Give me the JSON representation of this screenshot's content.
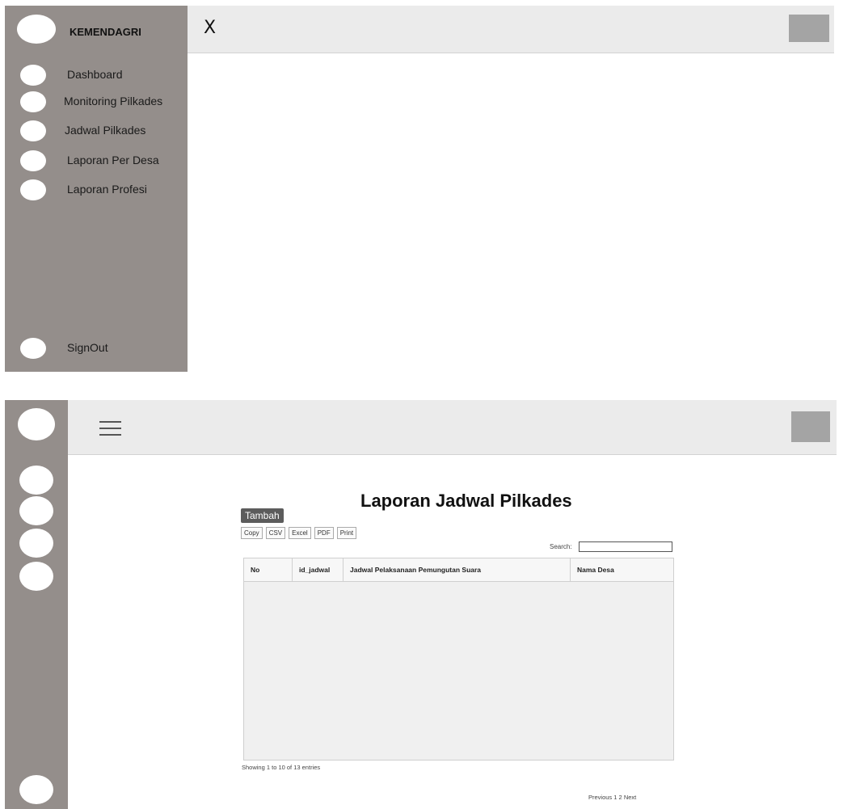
{
  "expanded_view": {
    "brand": "KEMENDAGRI",
    "close_glyph": "X",
    "nav": [
      {
        "label": "Dashboard"
      },
      {
        "label": "Monitoring Pilkades"
      },
      {
        "label": "Jadwal Pilkades"
      },
      {
        "label": "Laporan Per Desa"
      },
      {
        "label": "Laporan Profesi"
      }
    ],
    "signout": "SignOut"
  },
  "collapsed_view": {
    "page_title": "Laporan Jadwal Pilkades",
    "add_button": "Tambah",
    "export_buttons": [
      "Copy",
      "CSV",
      "Excel",
      "PDF",
      "Print"
    ],
    "search": {
      "label": "Search:",
      "value": ""
    },
    "table": {
      "columns": [
        "No",
        "id_jadwal",
        "Jadwal Pelaksanaan Pemungutan Suara",
        "Nama Desa"
      ],
      "rows": []
    },
    "info": "Showing 1 to 10 of 13 entries",
    "pagination": {
      "previous": "Previous",
      "pages": [
        "1",
        "2"
      ],
      "next": "Next"
    }
  },
  "colors": {
    "sidebar": "#948e8b",
    "topbar": "#ebebeb",
    "avatar_placeholder": "#a4a4a4",
    "primary_button": "#5c5c5c"
  },
  "icons": {
    "brand_logo": "circle-placeholder",
    "nav_icon": "circle-placeholder",
    "menu": "hamburger-icon",
    "close": "close-icon"
  }
}
